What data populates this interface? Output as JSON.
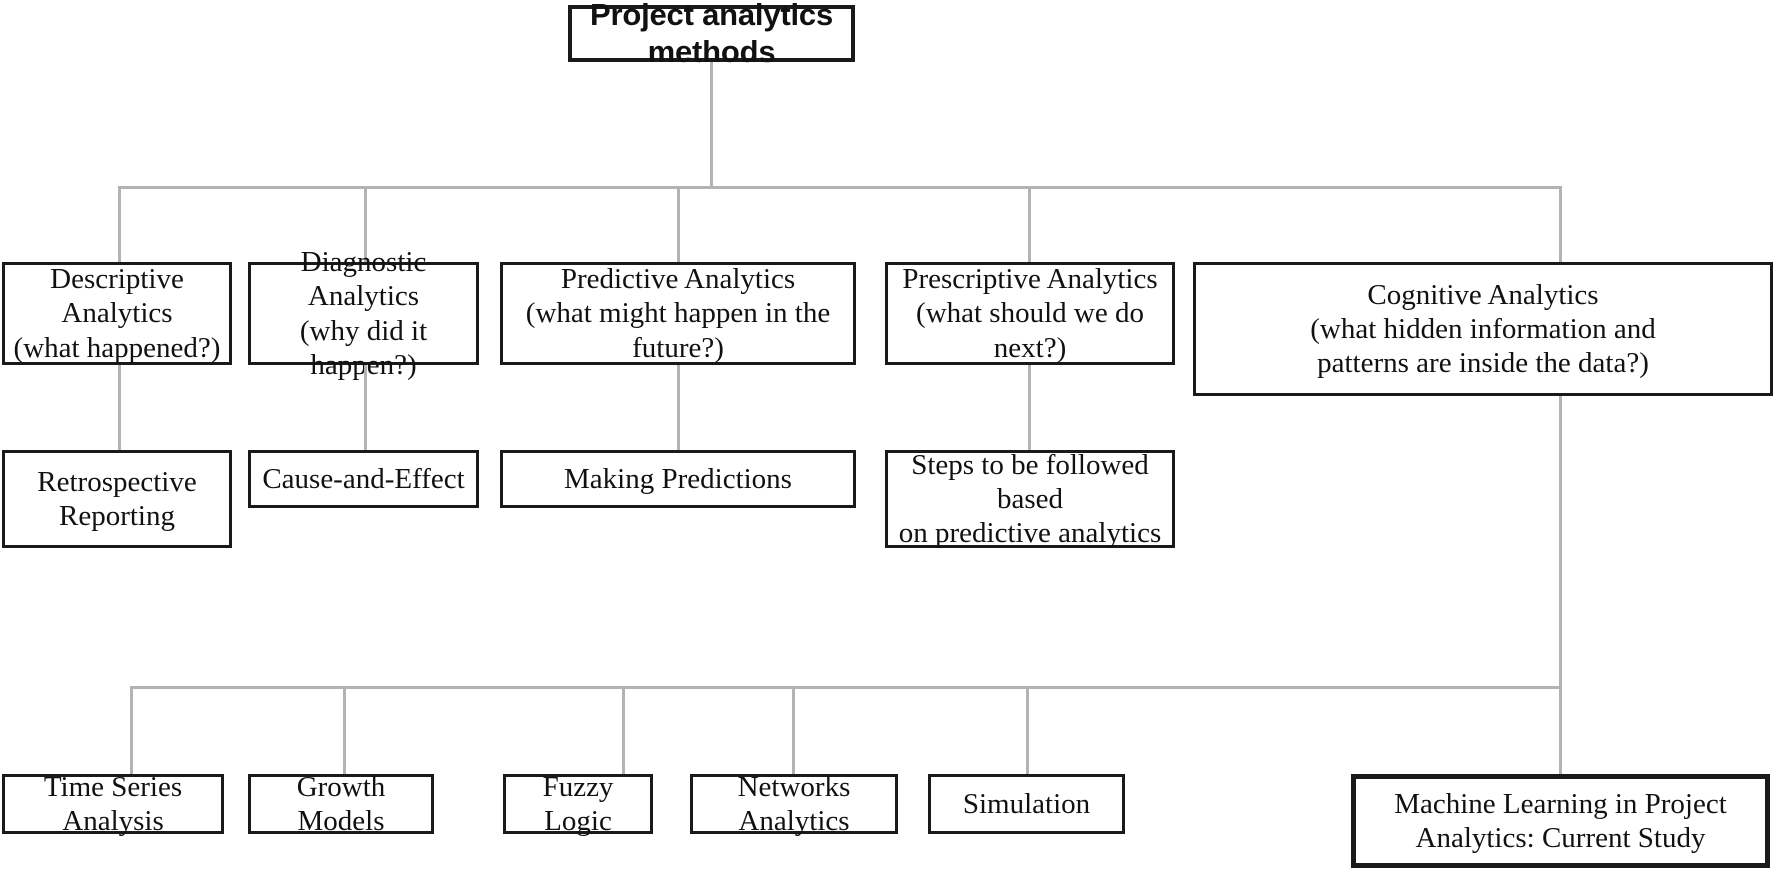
{
  "diagram": {
    "title_box": {
      "label": "Project analytics methods"
    },
    "level2": [
      {
        "label": "Descriptive Analytics\n(what happened?)"
      },
      {
        "label": "Diagnostic Analytics\n(why did it happen?)"
      },
      {
        "label": "Predictive Analytics\n(what might happen in the future?)"
      },
      {
        "label": "Prescriptive Analytics\n(what should we do next?)"
      },
      {
        "label": "Cognitive Analytics\n(what hidden information and\npatterns are inside the data?)"
      }
    ],
    "level3": [
      {
        "label": "Retrospective\nReporting"
      },
      {
        "label": "Cause-and-Effect"
      },
      {
        "label": "Making Predictions"
      },
      {
        "label": "Steps to be followed based\non predictive analytics"
      }
    ],
    "level4": [
      {
        "label": "Time Series Analysis"
      },
      {
        "label": "Growth Models"
      },
      {
        "label": "Fuzzy Logic"
      },
      {
        "label": "Networks Analytics"
      },
      {
        "label": "Simulation"
      },
      {
        "label": "Machine Learning in Project\nAnalytics: Current Study"
      }
    ],
    "colors": {
      "box_border": "#1a1a1a",
      "connector": "#b3b3b3",
      "background": "#ffffff",
      "text": "#111111"
    }
  }
}
